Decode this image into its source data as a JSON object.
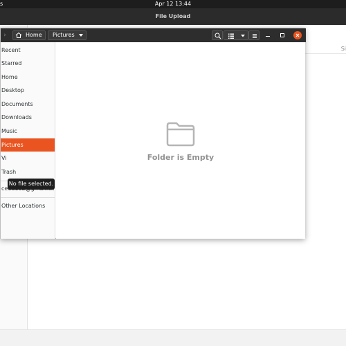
{
  "topbar": {
    "activities": "s",
    "clock": "Apr 12  13:44"
  },
  "background_dialog": {
    "title": "File Upload",
    "column_header": "Si"
  },
  "chooser": {
    "header": {
      "home_label": "Home",
      "current_folder": "Pictures"
    },
    "sidebar": {
      "items": [
        {
          "label": "Recent"
        },
        {
          "label": "Starred"
        },
        {
          "label": "Home"
        },
        {
          "label": "Desktop"
        },
        {
          "label": "Documents"
        },
        {
          "label": "Downloads"
        },
        {
          "label": "Music"
        },
        {
          "label": "Pictures"
        },
        {
          "label": "Vi"
        },
        {
          "label": "Trash"
        },
        {
          "label": "ceed162@gmail.c..."
        },
        {
          "label": "Other Locations"
        }
      ],
      "active_index": 7
    },
    "main": {
      "empty_message": "Folder is Empty"
    },
    "tooltip": "No file selected."
  },
  "colors": {
    "accent": "#e95420",
    "header": "#2d2d2d",
    "topbar": "#1d1d1d"
  }
}
